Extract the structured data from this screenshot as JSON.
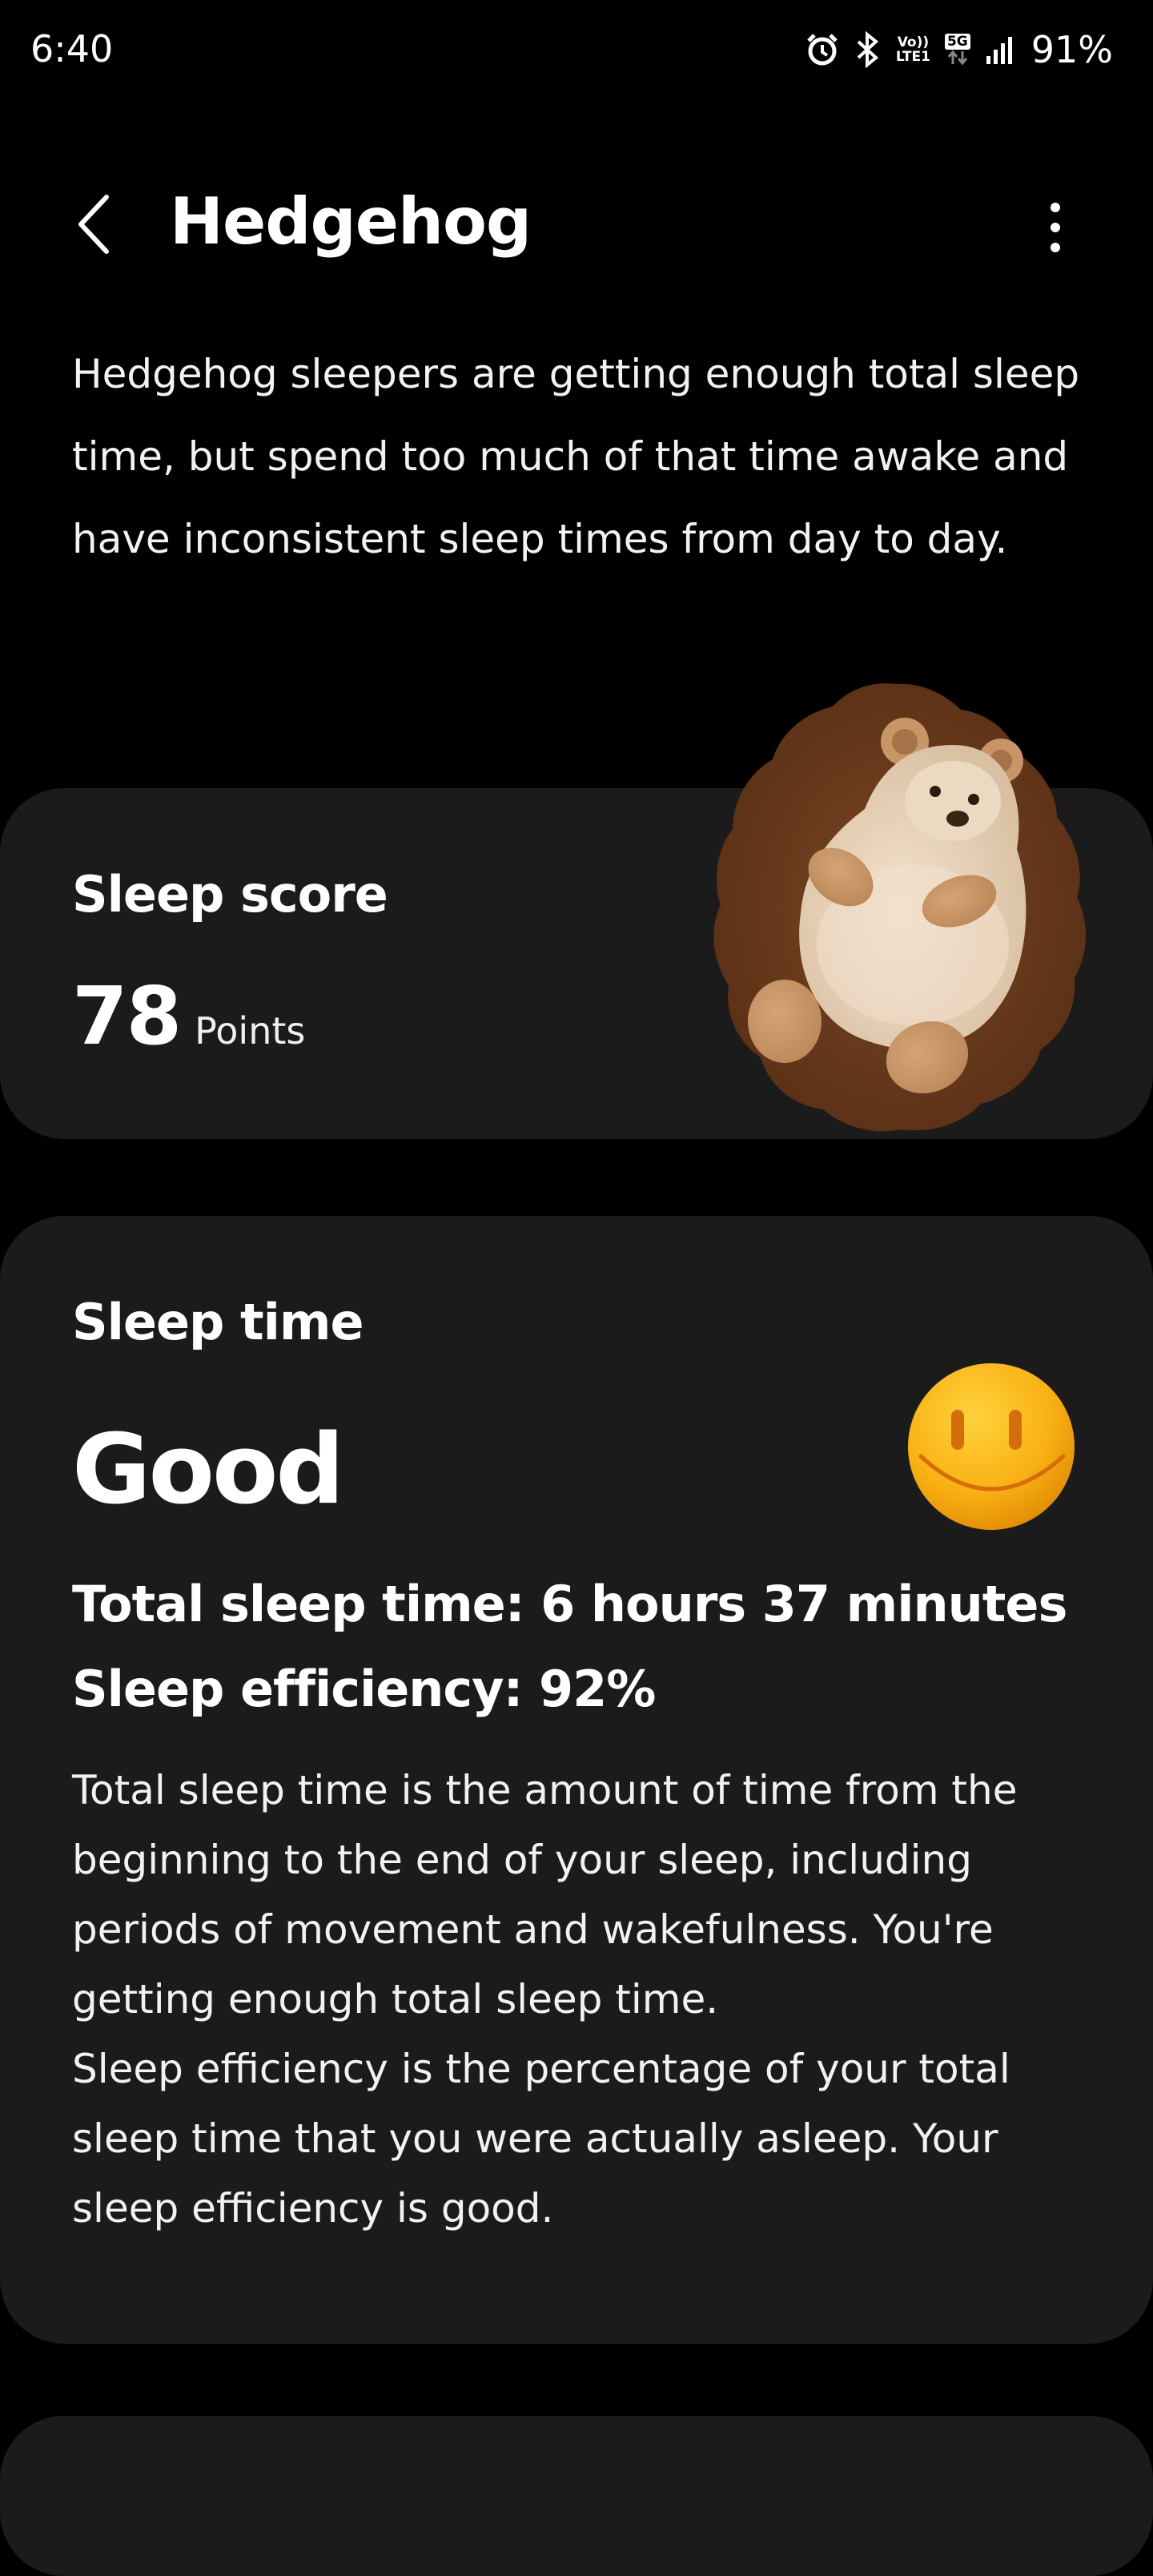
{
  "status_bar": {
    "time": "6:40",
    "battery": "91%",
    "network_top": "Vo))",
    "network_bottom": "LTE1",
    "badge": "5G",
    "icons": [
      "alarm-icon",
      "bluetooth-icon",
      "volte-icon",
      "5g-icon",
      "signal-icon"
    ]
  },
  "header": {
    "title": "Hedgehog",
    "back_icon": "back-arrow-icon",
    "menu_icon": "more-vertical-icon"
  },
  "description": "Hedgehog sleepers are getting enough total sleep time, but spend too much of that time awake and have inconsistent sleep times from day to day.",
  "sleep_score": {
    "title": "Sleep score",
    "value": "78",
    "unit": "Points",
    "illustration": "hedgehog-illustration"
  },
  "sleep_time": {
    "title": "Sleep time",
    "rating": "Good",
    "emoji": "smiley-icon",
    "total_line": "Total sleep time: 6 hours 37 minutes",
    "efficiency_line": "Sleep efficiency: 92%",
    "explanation_1": "Total sleep time is the amount of time from the beginning to the end of your sleep, including periods of movement and wakefulness. You're getting enough total sleep time.",
    "explanation_2": "Sleep efficiency is the percentage of your total sleep time that you were actually asleep. Your sleep efficiency is good."
  },
  "colors": {
    "background": "#000000",
    "card": "#1b1b1b",
    "text": "#ffffff",
    "smiley": "#f7a90f",
    "hedgehog_spikes": "#6b3b1c",
    "hedgehog_body": "#e9d3b9"
  }
}
